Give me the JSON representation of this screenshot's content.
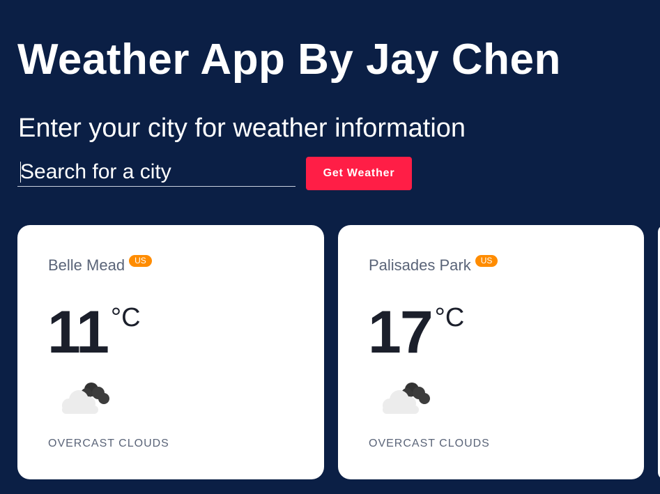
{
  "header": {
    "title": "Weather App By Jay Chen",
    "subtitle": "Enter your city for weather information"
  },
  "search": {
    "placeholder": "Search for a city",
    "value": "",
    "button_label": "Get Weather"
  },
  "cards": [
    {
      "city": "Belle Mead",
      "country": "US",
      "temperature": "11",
      "unit": "°C",
      "icon": "overcast-clouds-icon",
      "description": "OVERCAST CLOUDS"
    },
    {
      "city": "Palisades Park",
      "country": "US",
      "temperature": "17",
      "unit": "°C",
      "icon": "overcast-clouds-icon",
      "description": "OVERCAST CLOUDS"
    }
  ],
  "colors": {
    "background": "#0b1f45",
    "button": "#ff1e46",
    "badge": "#ff8c00",
    "card": "#ffffff"
  }
}
